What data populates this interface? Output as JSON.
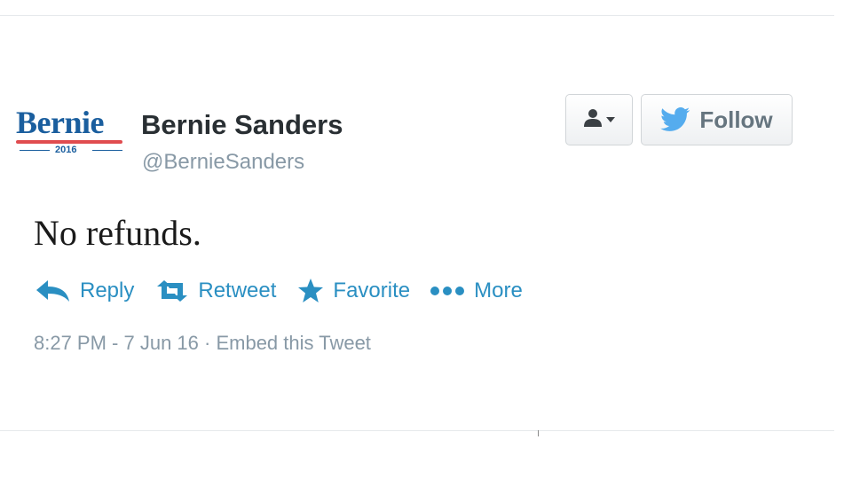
{
  "author": {
    "logo": {
      "word": "Bernie",
      "year": "2016",
      "colors": {
        "blue": "#1a5e9e",
        "red": "#e04c4f"
      }
    },
    "display_name": "Bernie Sanders",
    "handle": "@BernieSanders"
  },
  "buttons": {
    "user_dropdown_icon": "user-icon",
    "follow_icon": "twitter-bird-icon",
    "follow_label": "Follow"
  },
  "tweet": {
    "text": "No refunds."
  },
  "actions": {
    "reply": {
      "icon": "reply-arrow-icon",
      "label": "Reply"
    },
    "retweet": {
      "icon": "retweet-icon",
      "label": "Retweet"
    },
    "favorite": {
      "icon": "star-icon",
      "label": "Favorite"
    },
    "more": {
      "icon": "more-dots-icon",
      "label": "More"
    }
  },
  "meta": {
    "timestamp": "8:27 PM - 7 Jun 16",
    "separator": " · ",
    "embed_label": "Embed this Tweet"
  },
  "colors": {
    "link": "#2a8fc2",
    "muted": "#8899a6",
    "name": "#292f33",
    "twitter_blue": "#55acee"
  }
}
